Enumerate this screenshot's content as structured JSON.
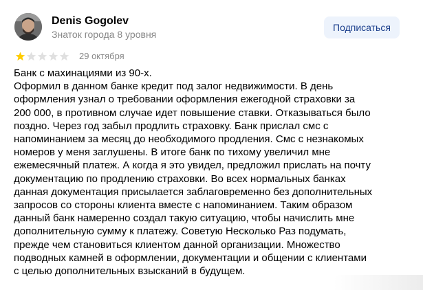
{
  "author": {
    "name": "Denis Gogolev",
    "level": "Знаток города 8 уровня"
  },
  "subscribe_label": "Подписаться",
  "rating": {
    "value": 1,
    "max": 5,
    "filled_color": "#fc0",
    "empty_color": "#e0e0e0"
  },
  "date": "29 октября",
  "text_lines": [
    "Банк с махинациями из 90-х.",
    "Оформил в данном банке кредит под залог недвижимости. В день",
    "оформления узнал о требовании оформления ежегодной страховки за",
    "200 000, в противном случае идет повышение ставки. Отказываться было",
    "поздно. Через год забыл продлить страховку. Банк прислал смс с",
    "напоминанием за месяц до необходимого продления. Смс с незнакомых",
    "номеров у меня заглушены. В итоге банк по тихому увеличил мне",
    "ежемесячный платеж. А когда я это увидел, предложил прислать на почту",
    "документацию по продлению страховки. Во всех нормальных банках",
    "данная документация присылается заблаговременно без дополнительных",
    "запросов со стороны клиента вместе с напоминанием. Таким образом",
    "данный банк намеренно создал такую ситуацию, чтобы начислить мне",
    "дополнительную сумму к платежу. Советую Несколько Раз подумать,",
    "прежде чем становиться клиентом данной организации. Множество",
    "подводных камней в оформлении, документации и общении с клиентами",
    "с целью дополнительных взысканий в будущем."
  ]
}
